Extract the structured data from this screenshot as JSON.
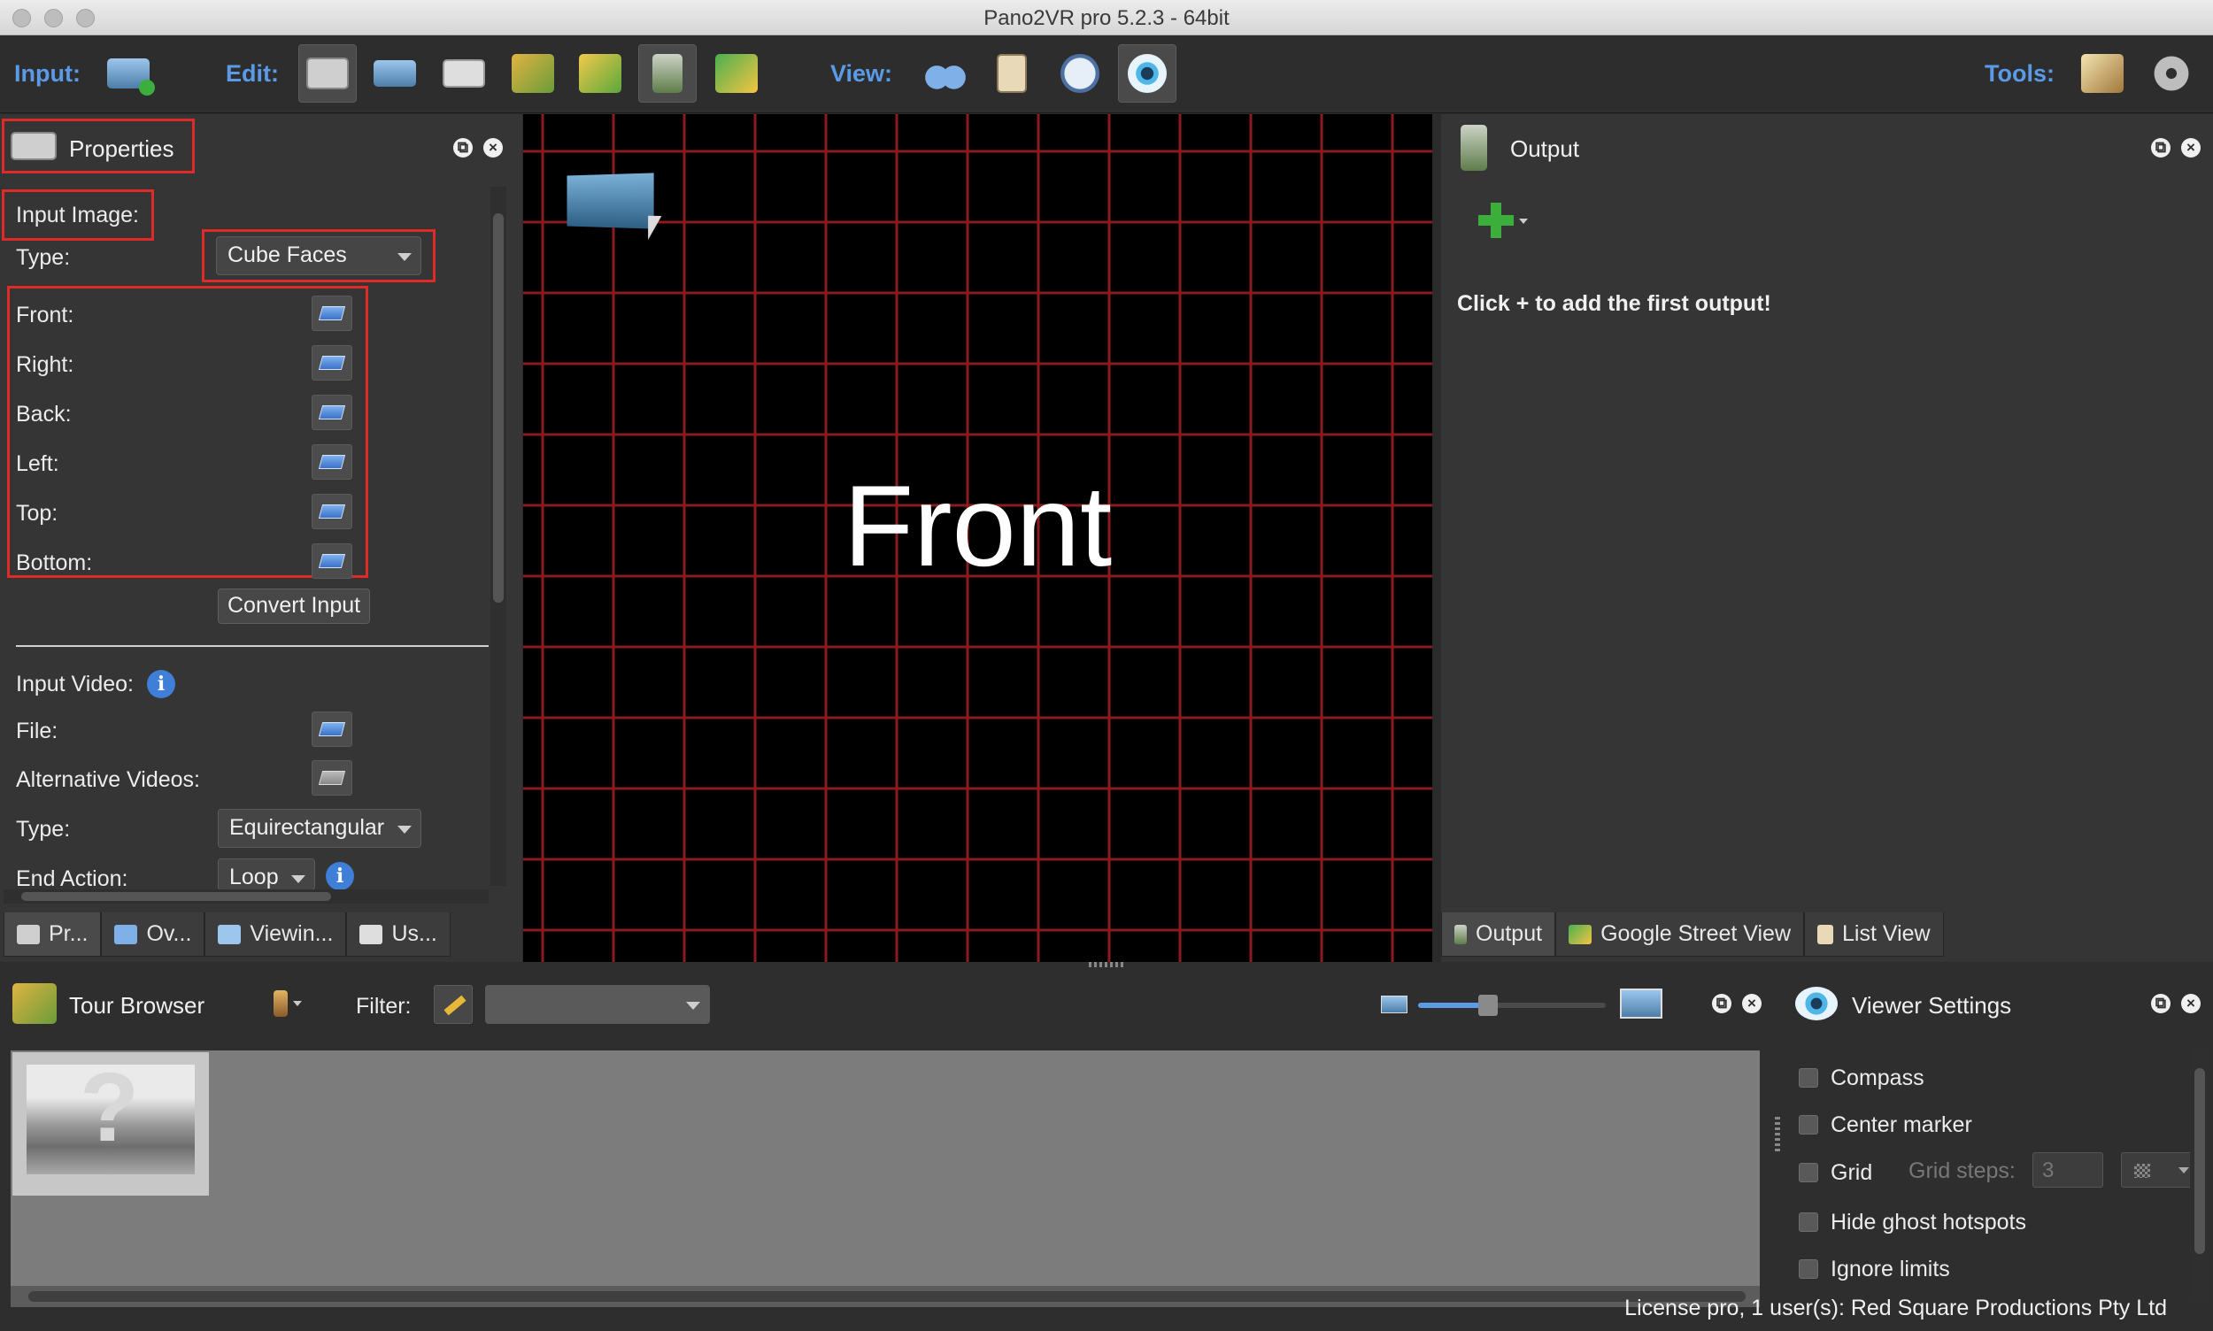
{
  "window": {
    "title": "Pano2VR pro 5.2.3 - 64bit"
  },
  "toolbar": {
    "input_label": "Input:",
    "edit_label": "Edit:",
    "view_label": "View:",
    "tools_label": "Tools:"
  },
  "properties": {
    "title": "Properties",
    "input_image_label": "Input Image:",
    "type_label": "Type:",
    "type_value": "Cube Faces",
    "faces": [
      "Front:",
      "Right:",
      "Back:",
      "Left:",
      "Top:",
      "Bottom:"
    ],
    "convert_button": "Convert Input",
    "input_video_label": "Input Video:",
    "file_label": "File:",
    "alt_videos_label": "Alternative Videos:",
    "video_type_label": "Type:",
    "video_type_value": "Equirectangular",
    "end_action_label": "End Action:",
    "end_action_value": "Loop",
    "tabs": [
      "Pr...",
      "Ov...",
      "Viewin...",
      "Us..."
    ]
  },
  "viewer": {
    "face_label": "Front"
  },
  "output": {
    "title": "Output",
    "empty_message": "Click + to add the first output!",
    "tabs": [
      "Output",
      "Google Street View",
      "List View"
    ]
  },
  "tour_browser": {
    "title": "Tour Browser",
    "filter_label": "Filter:",
    "filter_value": ""
  },
  "viewer_settings": {
    "title": "Viewer Settings",
    "options": [
      "Compass",
      "Center marker",
      "Grid",
      "Hide ghost hotspots",
      "Ignore limits"
    ],
    "grid_steps_label": "Grid steps:",
    "grid_steps_value": "3"
  },
  "status": {
    "license": "License pro, 1 user(s): Red Square Productions Pty Ltd"
  },
  "colors": {
    "accent_blue": "#5b9ae6",
    "highlight_red": "#e02a2a",
    "grid_red": "#8b1c1c"
  }
}
